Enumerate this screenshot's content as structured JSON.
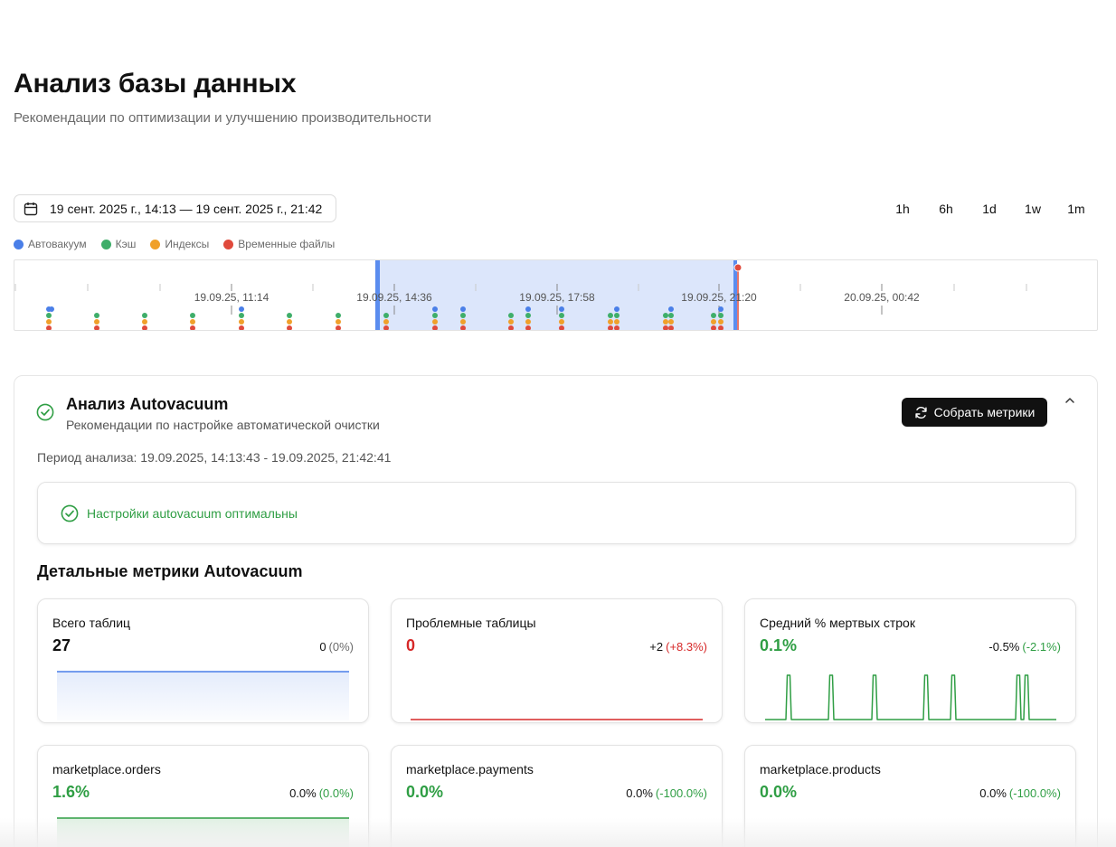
{
  "page": {
    "title": "Анализ базы данных",
    "subtitle": "Рекомендации по оптимизации и улучшению производительности"
  },
  "date_range": {
    "value": "19 сент. 2025 г., 14:13 — 19 сент. 2025 г., 21:42",
    "icon": "calendar-icon"
  },
  "range_buttons": [
    "1h",
    "6h",
    "1d",
    "1w",
    "1m"
  ],
  "legend": [
    {
      "label": "Автовакуум",
      "color": "#4a7fe8"
    },
    {
      "label": "Кэш",
      "color": "#3fae6a"
    },
    {
      "label": "Индексы",
      "color": "#f0a02a"
    },
    {
      "label": "Временные файлы",
      "color": "#e04a3c"
    }
  ],
  "timeline": {
    "tick_labels": [
      "19.09.25, 11:14",
      "19.09.25, 14:36",
      "19.09.25, 17:58",
      "19.09.25, 21:20",
      "20.09.25, 00:42"
    ],
    "selection_color": "#dce6fb",
    "handle_color": "#5b8def",
    "cursor_color": "#e04a3c"
  },
  "autovacuum": {
    "title": "Анализ Autovacuum",
    "subtitle": "Рекомендации по настройке автоматической очистки",
    "collect_label": "Собрать метрики",
    "period": "Период анализа: 19.09.2025, 14:13:43 - 19.09.2025, 21:42:41",
    "status": "Настройки autovacuum оптимальны",
    "status_color": "#2f9e44",
    "metrics_heading": "Детальные метрики Autovacuum",
    "metrics": [
      {
        "label": "Всего таблиц",
        "value": "27",
        "delta": "0",
        "delta_pct": "(0%)",
        "value_color": "#111111",
        "pct_color": "#6b6b6b",
        "line_color": "#4a7fe8",
        "chart": "flat-high",
        "series": [
          27,
          27
        ]
      },
      {
        "label": "Проблемные таблицы",
        "value": "0",
        "delta": "+2",
        "delta_pct": "(+8.3%)",
        "value_color": "#d62828",
        "pct_color": "#d62828",
        "line_color": "#d62828",
        "chart": "flat-low",
        "series": [
          0,
          0
        ]
      },
      {
        "label": "Средний % мертвых строк",
        "value": "0.1%",
        "delta": "-0.5%",
        "delta_pct": "(-2.1%)",
        "value_color": "#2f9e44",
        "pct_color": "#2f9e44",
        "line_color": "#2f9e44",
        "chart": "spikes"
      },
      {
        "label": "marketplace.orders",
        "value": "1.6%",
        "delta": "0.0%",
        "delta_pct": "(0.0%)",
        "value_color": "#2f9e44",
        "pct_color": "#2f9e44",
        "line_color": "#2f9e44",
        "chart": "flat-high-green"
      },
      {
        "label": "marketplace.payments",
        "value": "0.0%",
        "delta": "0.0%",
        "delta_pct": "(-100.0%)",
        "value_color": "#2f9e44",
        "pct_color": "#2f9e44",
        "line_color": "#2f9e44",
        "chart": "none"
      },
      {
        "label": "marketplace.products",
        "value": "0.0%",
        "delta": "0.0%",
        "delta_pct": "(-100.0%)",
        "value_color": "#2f9e44",
        "pct_color": "#2f9e44",
        "line_color": "#2f9e44",
        "chart": "none"
      }
    ]
  }
}
